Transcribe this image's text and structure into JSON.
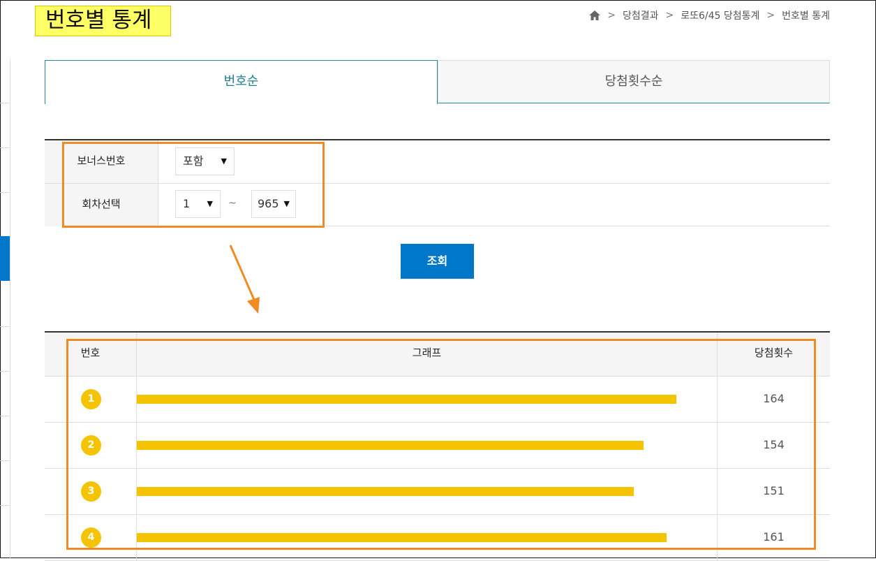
{
  "page": {
    "title": "번호별 통계"
  },
  "breadcrumb": {
    "icon": "home-icon",
    "items": [
      "당첨결과",
      "로또6/45 당첨통계",
      "번호별 통계"
    ]
  },
  "tabs": [
    {
      "label": "번호순",
      "active": true
    },
    {
      "label": "당첨횟수순",
      "active": false
    }
  ],
  "filter": {
    "bonus": {
      "label": "보너스번호",
      "selected": "포함"
    },
    "round": {
      "label": "회차선택",
      "from": "1",
      "separator": "~",
      "to": "965"
    }
  },
  "search_button": {
    "label": "조회"
  },
  "table": {
    "headers": {
      "number": "번호",
      "graph": "그래프",
      "count": "당첨횟수"
    },
    "rows": [
      {
        "number": "1",
        "count": "164"
      },
      {
        "number": "2",
        "count": "154"
      },
      {
        "number": "3",
        "count": "151"
      },
      {
        "number": "4",
        "count": "161"
      }
    ]
  },
  "colors": {
    "accent_blue": "#0077c8",
    "ball_yellow": "#f5c400",
    "highlight_orange": "#f08a22",
    "title_highlight": "#ffff66"
  }
}
